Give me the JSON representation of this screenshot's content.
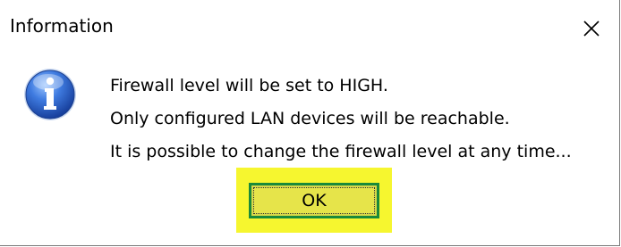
{
  "dialog": {
    "title": "Information",
    "close_glyph": "✕",
    "icon": "info-icon",
    "messages": [
      "Firewall level will be set to HIGH.",
      "Only configured LAN devices will be reachable.",
      "It is possible to change the firewall level at any time..."
    ],
    "ok_label": "OK"
  },
  "colors": {
    "highlight": "#f4f40a",
    "button_border": "#1a8a3a",
    "icon_blue": "#2a5fc4"
  }
}
